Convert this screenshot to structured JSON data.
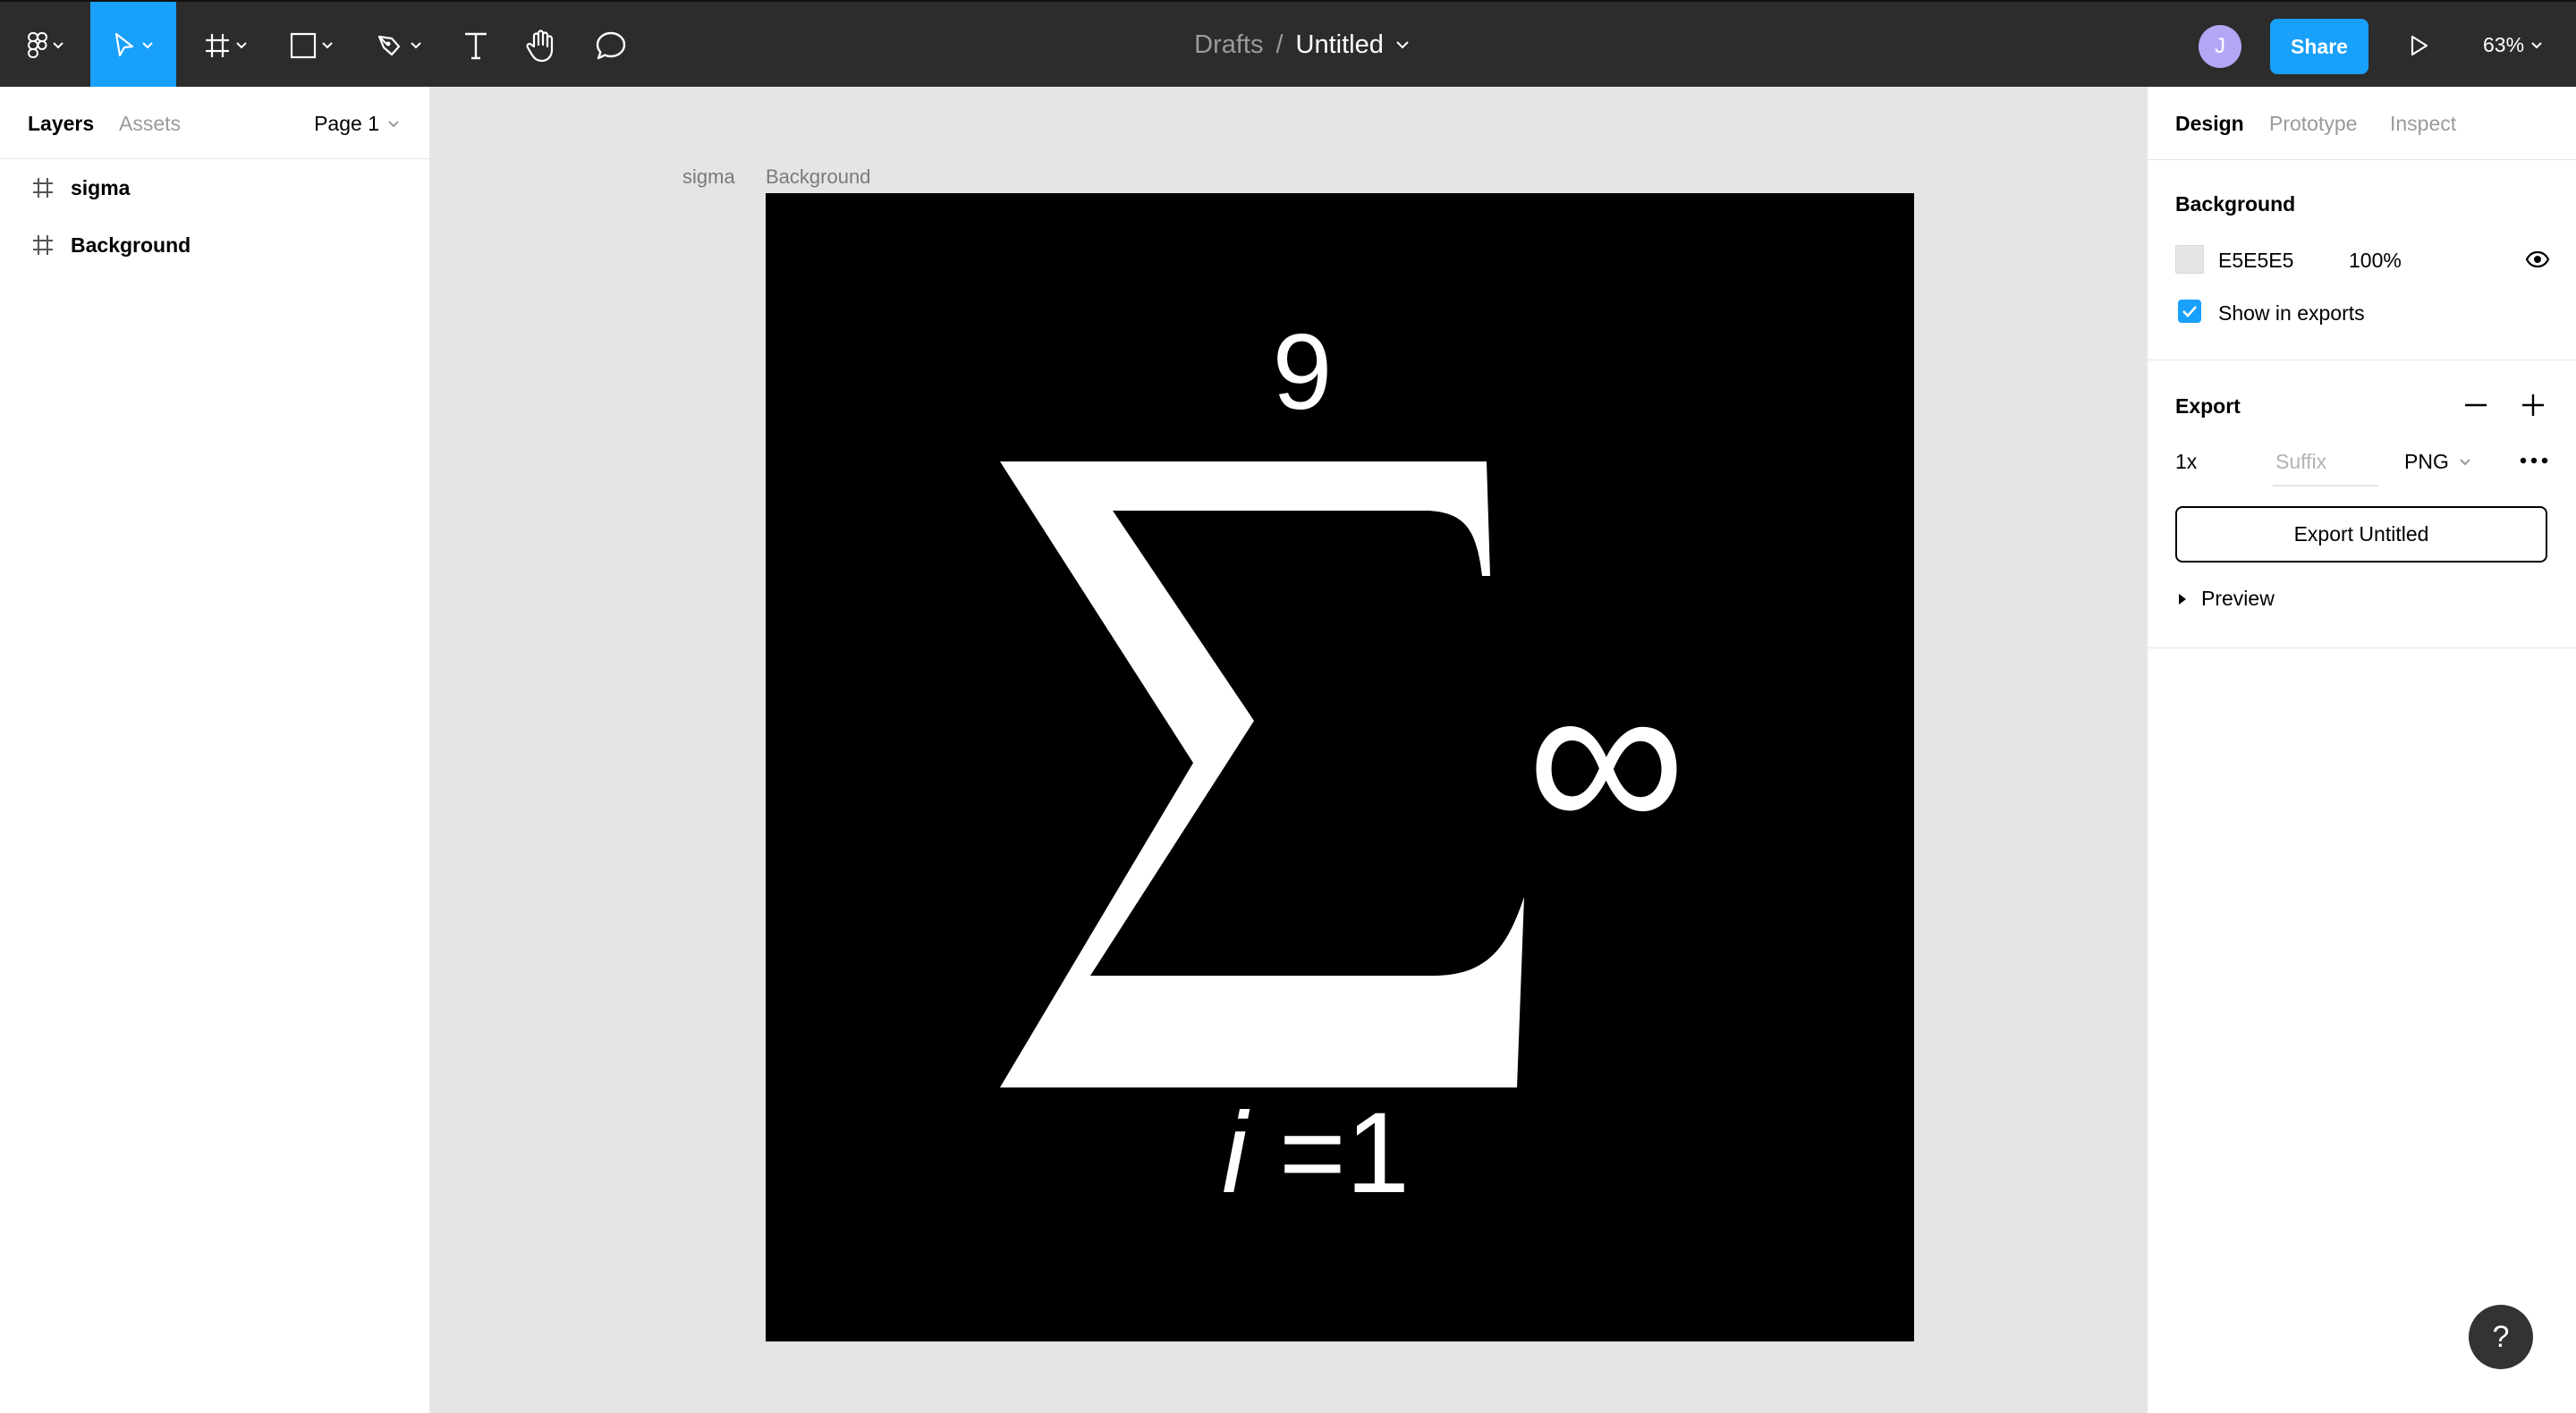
{
  "toolbar": {
    "breadcrumb_folder": "Drafts",
    "breadcrumb_separator": "/",
    "file_name": "Untitled",
    "avatar_initial": "J",
    "share_label": "Share",
    "zoom_label": "63%",
    "accent_color": "#18a0fb"
  },
  "left_panel": {
    "tabs": [
      "Layers",
      "Assets"
    ],
    "page_label": "Page 1",
    "layers": [
      {
        "name": "sigma",
        "icon": "frame-icon"
      },
      {
        "name": "Background",
        "icon": "frame-icon"
      }
    ]
  },
  "canvas": {
    "frame_labels": [
      "sigma",
      "Background"
    ],
    "art": {
      "upper_limit": "9",
      "infinity": "∞",
      "lower_var": "i",
      "lower_rest": " =1",
      "background_color": "#000000",
      "foreground_color": "#ffffff"
    }
  },
  "right_panel": {
    "tabs": [
      "Design",
      "Prototype",
      "Inspect"
    ],
    "background": {
      "title": "Background",
      "color_hex": "E5E5E5",
      "opacity": "100%",
      "show_in_exports_label": "Show in exports",
      "show_in_exports_checked": true
    },
    "export": {
      "title": "Export",
      "scale": "1x",
      "suffix_placeholder": "Suffix",
      "format": "PNG",
      "export_button_label": "Export Untitled",
      "preview_label": "Preview"
    }
  },
  "help_label": "?"
}
